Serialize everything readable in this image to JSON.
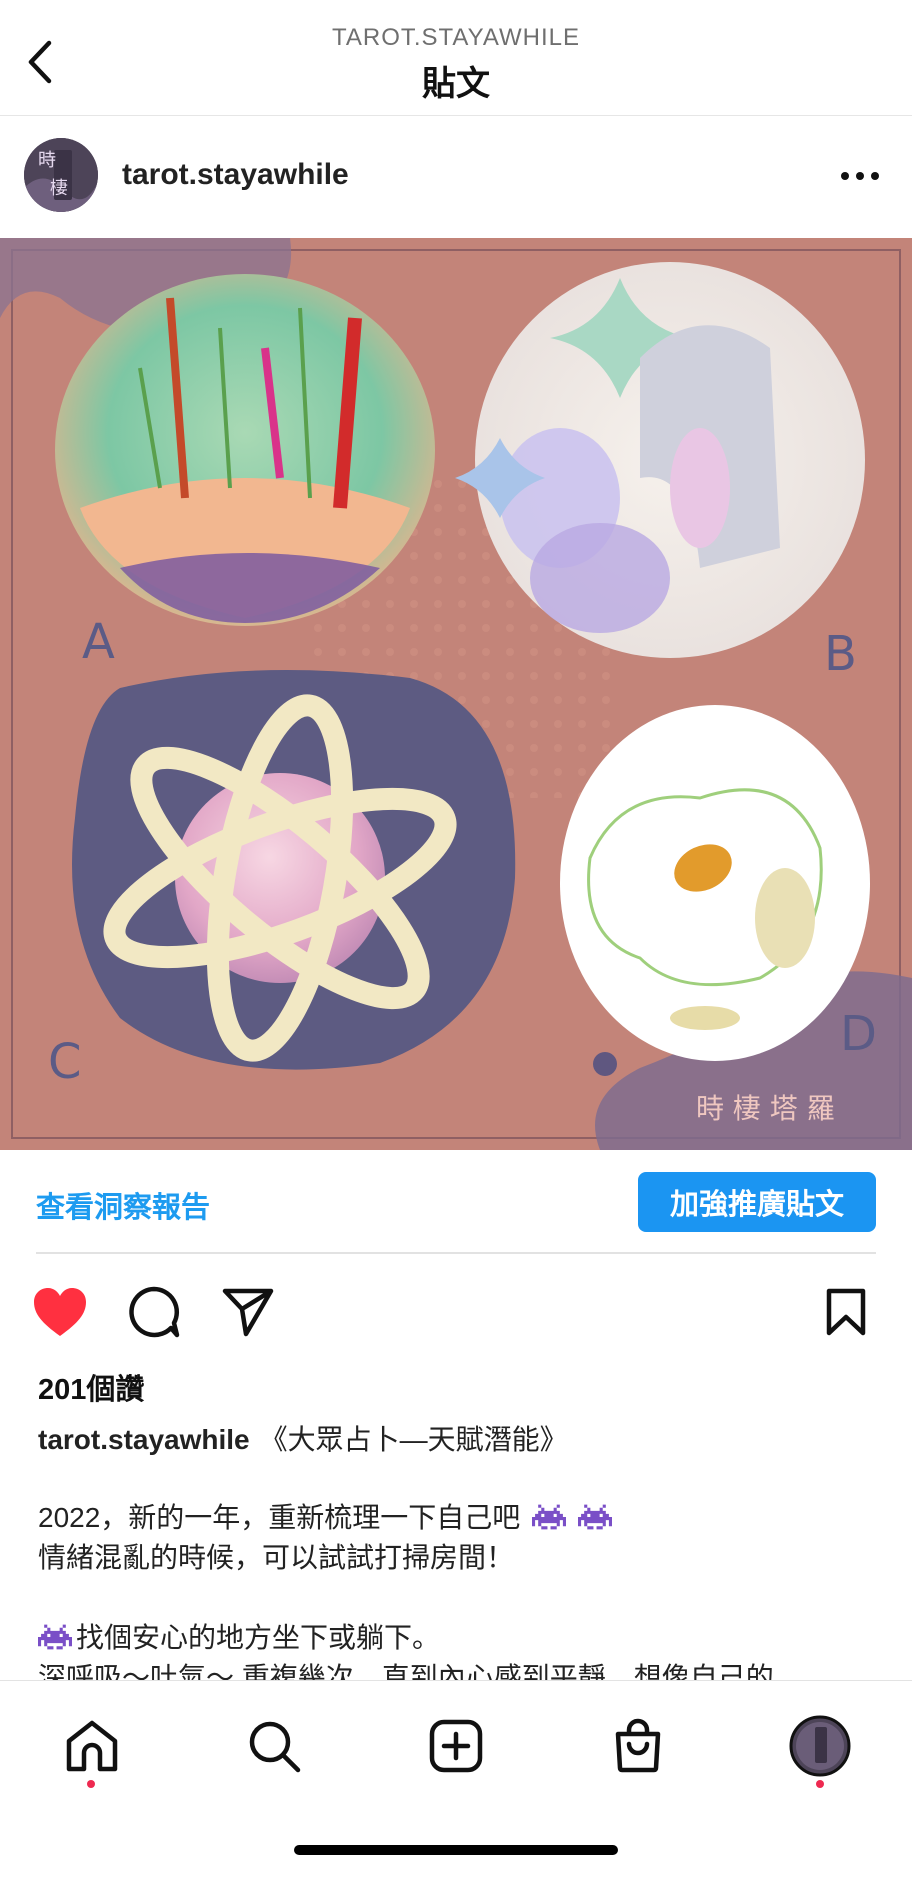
{
  "header": {
    "subtitle": "TAROT.STAYAWHILE",
    "title": "貼文",
    "back_icon": "chevron-left-icon"
  },
  "post": {
    "author": "tarot.stayawhile",
    "avatar_text": [
      "時",
      "棲"
    ],
    "more_icon": "ellipsis-icon",
    "image": {
      "labels": [
        "A",
        "B",
        "C",
        "D"
      ],
      "watermark": "時 棲 塔 羅",
      "background_color": "#c38479"
    }
  },
  "insights": {
    "link_label": "查看洞察報告",
    "promote_label": "加強推廣貼文"
  },
  "actions": {
    "like_icon": "heart-icon",
    "comment_icon": "comment-icon",
    "share_icon": "paper-plane-icon",
    "save_icon": "bookmark-icon",
    "liked": true,
    "like_color": "#ff3040"
  },
  "likes_text": "201個讚",
  "caption": {
    "username": "tarot.stayawhile",
    "title": "《大眾占卜—天賦潛能》",
    "line1": "2022，新的一年，重新梳理一下自己吧",
    "line2": "情緒混亂的時候，可以試試打掃房間！",
    "line3": "找個安心的地方坐下或躺下。",
    "line4": "深呼吸～吐氣～ 重複幾次，直到內心感到平靜，想像自己的"
  },
  "bottom_nav": {
    "items": [
      "home-icon",
      "search-icon",
      "create-icon",
      "shop-icon",
      "profile-avatar"
    ],
    "notification_color": "#ee2950"
  }
}
